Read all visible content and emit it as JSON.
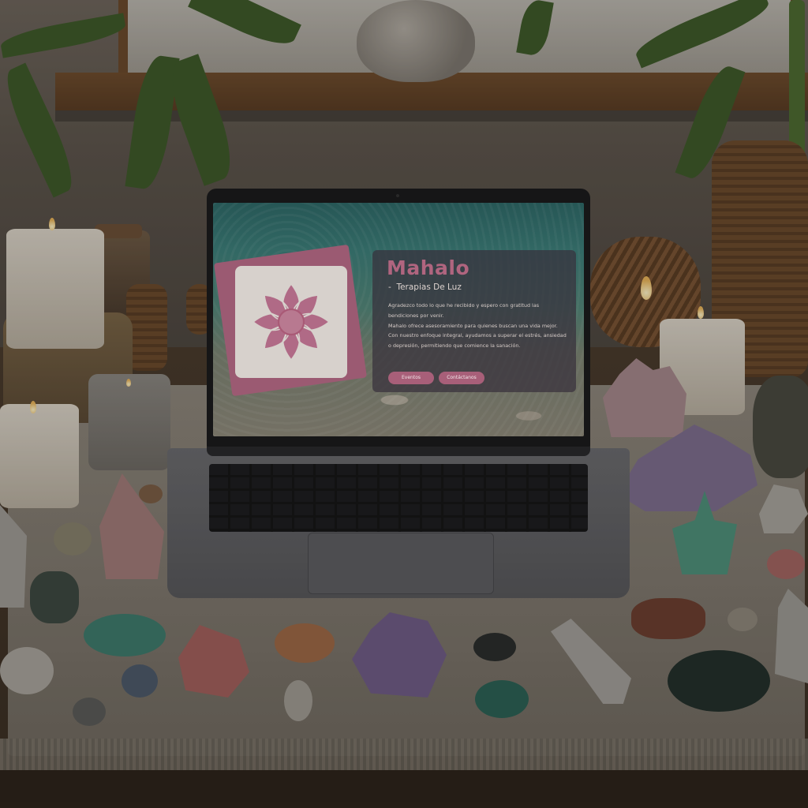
{
  "website": {
    "title": "Mahalo",
    "subtitle": "Terapias De Luz",
    "body_line_1": "Agradezco todo lo que he recibido y espero con gratitud las bendiciones por venir.",
    "body_line_2": "Mahalo ofrece asesoramiento para quienes buscan una vida mejor. Con nuestro enfoque integral, ayudamos a superar el estrés, ansiedad o depresión, permitiendo que comience la sanación.",
    "buttons": {
      "events": "Eventos",
      "contact": "Contáctanos"
    },
    "colors": {
      "accent": "#a85f79",
      "title": "#b0657f",
      "panel": "#38303c"
    }
  }
}
